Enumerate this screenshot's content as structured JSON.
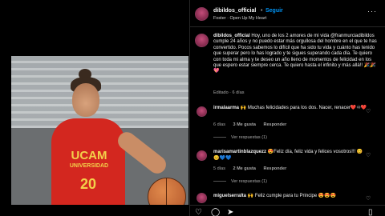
{
  "post": {
    "username": "dibildos_official",
    "follow_label": "Seguir",
    "dot": "•",
    "subtitle": "Foster · Open Up My Heart",
    "more_label": "···",
    "caption_user": "dibildos_official",
    "caption_text": "Hoy, uno de los 2 amores de mi vida @franmurciadibildos cumple 24 años y no puedo estar más orgullosa del hombre en el que te has convertido. Pocos sabemos lo difícil que ha sido tu vida y cuánto has tenido que superar pero lo has logrado y te sigues superando cada día. Te quiero con toda mi alma y te deseo un año lleno de momentos de felicidad en los que espero estar siempre cerca. Te quiero hasta el infinito y más allá!! 🎉🎉💖",
    "caption_meta": "Editado · 6 días"
  },
  "photo": {
    "jersey_text": "UCAM",
    "jersey_sub": "UNIVERSIDAD",
    "jersey_number": "20"
  },
  "comments": [
    {
      "user": "irmalaarma",
      "text": "🙌 Muchas felicidades para los dos. Nacer, renacer❤️♾❤️",
      "age": "6 días",
      "likes": "3 Me gusta",
      "reply": "Responder",
      "replies": "Ver respuestas (1)"
    },
    {
      "user": "marisamartinblazquezz",
      "text": "😍Feliz día, feliz vida y felices vosotros!!! 😊😊💙💙",
      "age": "5 días",
      "likes": "2 Me gusta",
      "reply": "Responder",
      "replies": "Ver respuestas (1)"
    },
    {
      "user": "miguelserralta",
      "text": "🙌 Feliz cumple para tu Principe 😍😍😍",
      "age": "",
      "likes": "",
      "reply": "",
      "replies": ""
    }
  ],
  "icons": {
    "heart": "♡",
    "like": "♡",
    "comment": "◯",
    "share": "➤",
    "save": "▯"
  },
  "colors": {
    "accent": "#0095f6",
    "background": "#000000",
    "muted": "#a8a8a8"
  }
}
